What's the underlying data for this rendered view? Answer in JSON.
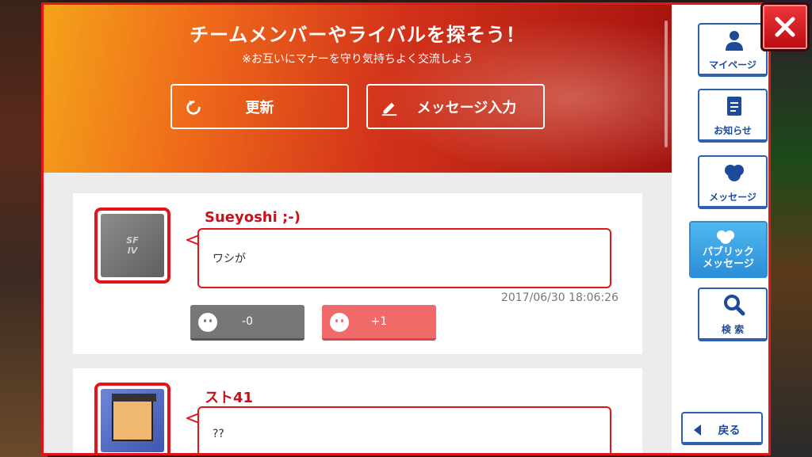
{
  "header": {
    "title": "チームメンバーやライバルを探そう！",
    "subtitle": "※お互いにマナーを守り気持ちよく交流しよう",
    "refresh_label": "更新",
    "message_input_label": "メッセージ入力"
  },
  "posts": [
    {
      "username": "Sueyoshi ;-)",
      "message": "ワシが",
      "timestamp": "2017/06/30 18:06:26",
      "dislike_count": "-0",
      "like_count": "+1"
    },
    {
      "username": "スト41",
      "message": "??"
    }
  ],
  "sidenav": {
    "mypage": "マイページ",
    "news": "お知らせ",
    "message": "メッセージ",
    "public_message_line1": "パブリック",
    "public_message_line2": "メッセージ",
    "search": "検 索",
    "back": "戻る"
  },
  "colors": {
    "accent_red": "#e3141a",
    "nav_blue": "#1d4a9a",
    "active_nav": "#2c8fd8",
    "like_pink": "#f06a6a",
    "dislike_gray": "#777777"
  }
}
